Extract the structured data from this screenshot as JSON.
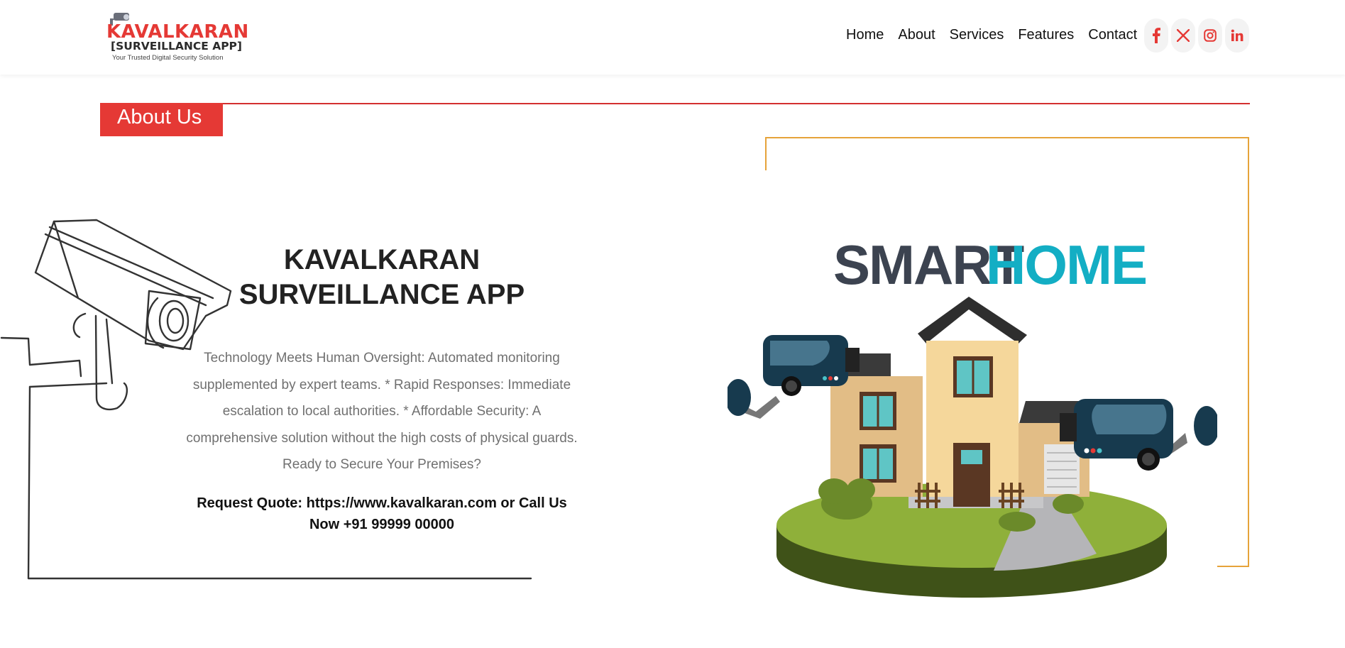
{
  "brand": {
    "name": "KAVALKARAN",
    "subtitle": "[SURVEILLANCE APP]",
    "tagline": "Your Trusted Digital Security Solution",
    "primary_color": "#e53935"
  },
  "nav": {
    "items": [
      {
        "label": "Home"
      },
      {
        "label": "About"
      },
      {
        "label": "Services"
      },
      {
        "label": "Features"
      },
      {
        "label": "Contact"
      }
    ]
  },
  "social": [
    {
      "icon": "facebook-icon"
    },
    {
      "icon": "x-twitter-icon"
    },
    {
      "icon": "instagram-icon"
    },
    {
      "icon": "linkedin-icon"
    }
  ],
  "section": {
    "label": "About Us"
  },
  "about": {
    "heading": "KAVALKARAN SURVEILLANCE APP",
    "description": "Technology Meets Human Oversight: Automated monitoring supplemented by expert teams. * Rapid Responses: Immediate escalation to local authorities. * Affordable Security: A comprehensive solution without the high costs of physical guards. Ready to Secure Your Premises?",
    "cta": "Request Quote: https://www.kavalkaran.com or Call Us Now +91 99999 00000"
  },
  "illustration": {
    "word_dark": "SMART",
    "word_accent": "HOME",
    "dark_color": "#3c4350",
    "accent_color": "#13aec4"
  }
}
